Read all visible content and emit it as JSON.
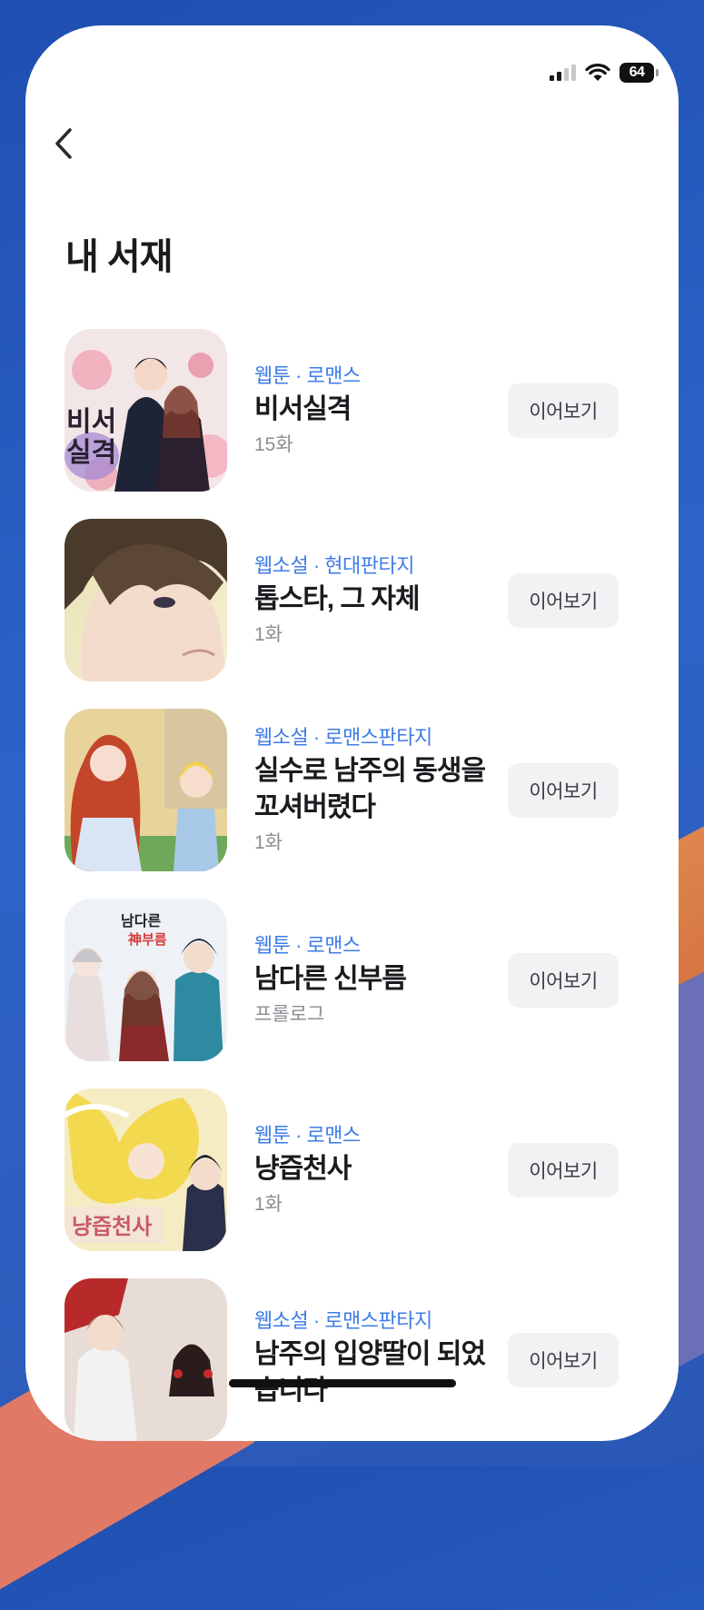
{
  "status_bar": {
    "battery": "64"
  },
  "header": {
    "title": "내 서재"
  },
  "continue_label": "이어보기",
  "books": [
    {
      "genre": "웹툰 · 로맨스",
      "title": "비서실격",
      "episode": "15화",
      "cover_text": "비서\n실격"
    },
    {
      "genre": "웹소설 · 현대판타지",
      "title": "톱스타, 그 자체",
      "episode": "1화"
    },
    {
      "genre": "웹소설 · 로맨스판타지",
      "title": "실수로 남주의 동생을 꼬셔버렸다",
      "episode": "1화"
    },
    {
      "genre": "웹툰 · 로맨스",
      "title": "남다른 신부름",
      "episode": "프롤로그",
      "cover_text": "남다른 神부름"
    },
    {
      "genre": "웹툰 · 로맨스",
      "title": "냥즙천사",
      "episode": "1화",
      "cover_text": "냥즙천사"
    },
    {
      "genre": "웹소설 · 로맨스판타지",
      "title": "남주의 입양딸이 되었습니다",
      "episode": ""
    }
  ]
}
